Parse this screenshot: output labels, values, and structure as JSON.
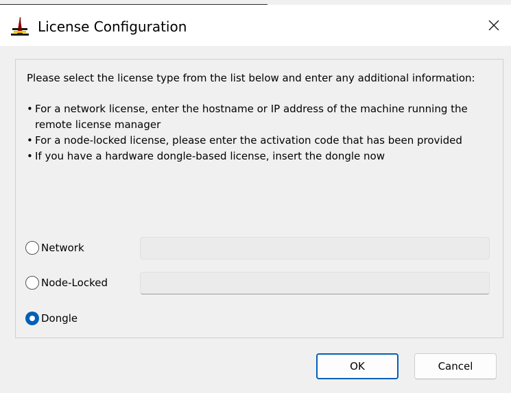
{
  "window": {
    "title": "License Configuration",
    "close_icon": "close-icon",
    "app_icon": "license-app-icon"
  },
  "instructions": {
    "intro": "Please select the license type from the list below and enter any additional information:",
    "bullets": [
      "For a network license, enter the hostname or IP address of the machine running the remote license manager",
      "For a node-locked license, please enter the activation code that has been provided",
      "If you have a hardware dongle-based license, insert the dongle now"
    ]
  },
  "options": {
    "network": {
      "label": "Network",
      "value": "",
      "checked": false
    },
    "node_locked": {
      "label": "Node-Locked",
      "value": "",
      "checked": false
    },
    "dongle": {
      "label": "Dongle",
      "checked": true
    }
  },
  "buttons": {
    "ok_label": "OK",
    "cancel_label": "Cancel"
  },
  "colors": {
    "accent": "#005fb8",
    "background": "#f0f0f0",
    "titlebar": "#ffffff",
    "field_background": "#ebebeb"
  }
}
